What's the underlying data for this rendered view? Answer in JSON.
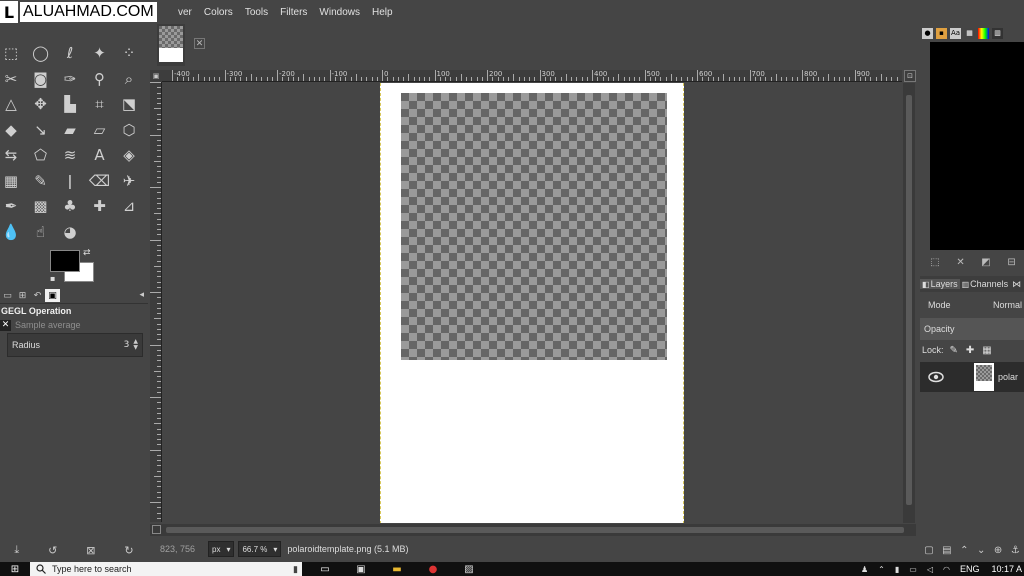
{
  "watermark": {
    "letter": "L",
    "text": "ALUAHMAD.COM"
  },
  "menubar": {
    "items": [
      "ver",
      "Colors",
      "Tools",
      "Filters",
      "Windows",
      "Help"
    ]
  },
  "toolbox": {
    "tools": [
      "rect-select-icon",
      "ellipse-select-icon",
      "free-select-icon",
      "fuzzy-select-icon",
      "select-by-color-icon",
      "scissors-icon",
      "foreground-select-icon",
      "paths-icon",
      "color-picker-icon",
      "zoom-icon",
      "measure-icon",
      "move-icon",
      "align-icon",
      "crop-icon",
      "unified-transform-icon",
      "warp-icon",
      "handle-transform-icon",
      "shear-icon",
      "perspective-icon",
      "3d-transform-icon",
      "flip-icon",
      "cage-icon",
      "warp-transform-icon",
      "text-icon",
      "bucket-fill-icon",
      "gradient-icon",
      "pencil-icon",
      "paintbrush-icon",
      "eraser-icon",
      "airbrush-icon",
      "ink-icon",
      "mypaint-brush-icon",
      "clone-icon",
      "heal-icon",
      "perspective-clone-icon",
      "blur-icon",
      "smudge-icon",
      "dodge-burn-icon"
    ],
    "colors": {
      "foreground": "#000000",
      "background": "#ffffff"
    }
  },
  "tool_options": {
    "title": "GEGL Operation",
    "sample_label": "Sample average",
    "radius_label": "Radius",
    "radius_value": "3"
  },
  "rulers": {
    "h_labels": [
      "-400",
      "-300",
      "-200",
      "-100",
      "0",
      "100",
      "200",
      "300",
      "400",
      "500",
      "600",
      "700",
      "800",
      "900"
    ]
  },
  "statusbar": {
    "coords": "823, 756",
    "unit": "px",
    "zoom": "66.7 %",
    "file_info": "polaroidtemplate.png (5.1 MB)"
  },
  "layers_panel": {
    "tab_layers": "Layers",
    "tab_channels": "Channels",
    "mode_label": "Mode",
    "mode_value": "Normal",
    "opacity_label": "Opacity",
    "lock_label": "Lock:",
    "layer_name": "polar"
  },
  "taskbar": {
    "search_placeholder": "Type here to search",
    "lang": "ENG",
    "time": "10:17 A"
  }
}
